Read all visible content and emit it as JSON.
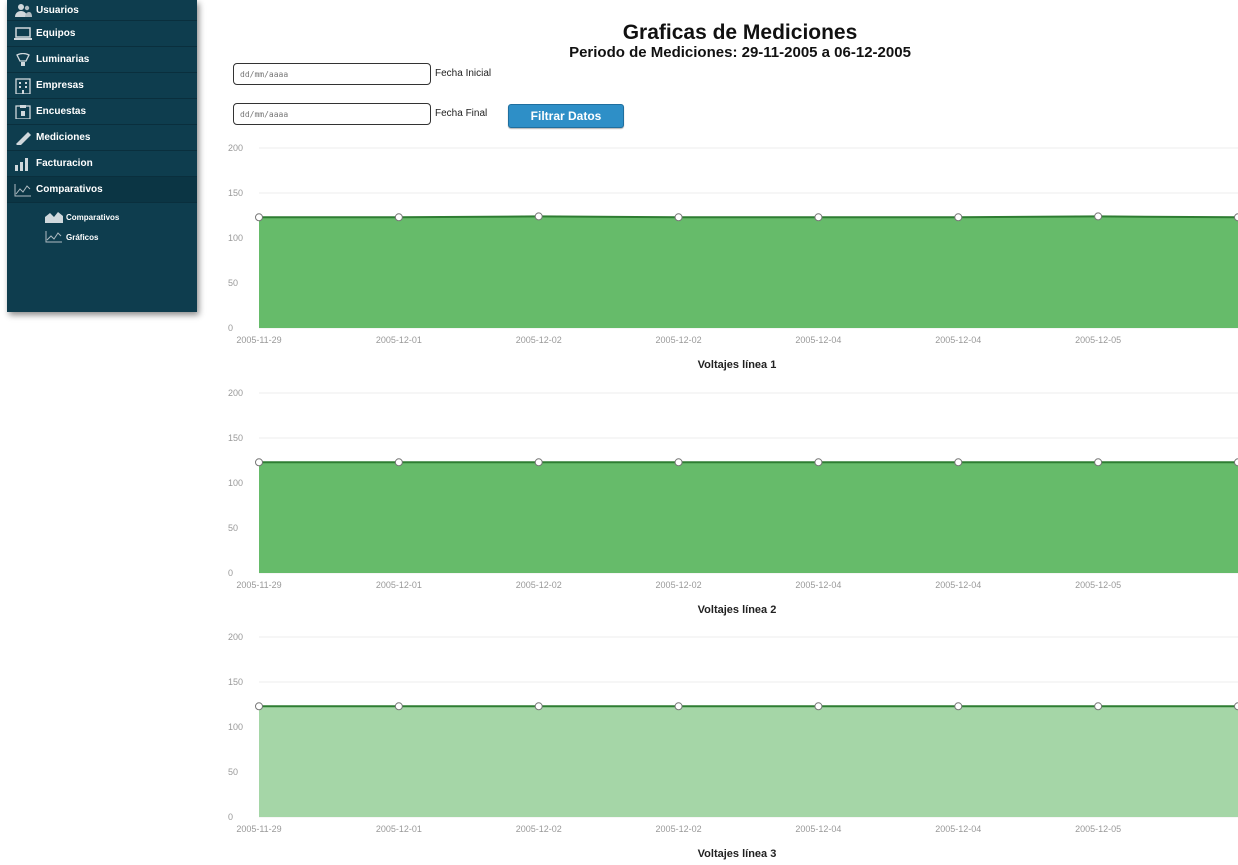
{
  "sidebar": {
    "items": [
      {
        "label": "Usuarios",
        "icon": "users-icon"
      },
      {
        "label": "Equipos",
        "icon": "computer-icon"
      },
      {
        "label": "Luminarias",
        "icon": "lamp-icon"
      },
      {
        "label": "Empresas",
        "icon": "building-icon"
      },
      {
        "label": "Encuestas",
        "icon": "clipboard-icon"
      },
      {
        "label": "Mediciones",
        "icon": "pencil-icon"
      },
      {
        "label": "Facturacion",
        "icon": "bar-chart-icon"
      },
      {
        "label": "Comparativos",
        "icon": "line-chart-icon"
      }
    ],
    "subitems": [
      {
        "label": "Comparativos",
        "icon": "area-chart-icon"
      },
      {
        "label": "Gráficos",
        "icon": "line-chart-icon"
      }
    ]
  },
  "header": {
    "title": "Graficas de Mediciones",
    "subtitle": "Periodo de Mediciones: 29-11-2005 a 06-12-2005"
  },
  "filters": {
    "start_placeholder": "dd/mm/aaaa",
    "start_label": "Fecha Inicial",
    "end_placeholder": "dd/mm/aaaa",
    "end_label": "Fecha Final",
    "button_label": "Filtrar Datos"
  },
  "colors": {
    "sidebar_bg": "#0e3d4e",
    "area_fill": "#66bb6a",
    "area_fill_light": "#a5d6a7",
    "line": "#2e7d32",
    "button": "#2e8fc7"
  },
  "chart_data": [
    {
      "type": "area",
      "title": "Voltajes línea 1",
      "x": [
        "2005-11-29",
        "2005-12-01",
        "2005-12-02",
        "2005-12-02",
        "2005-12-04",
        "2005-12-04",
        "2005-12-05",
        ""
      ],
      "values": [
        123,
        123,
        124,
        123,
        123,
        123,
        124,
        123
      ],
      "yticks": [
        0,
        50,
        100,
        150,
        200
      ],
      "ylim": [
        0,
        200
      ],
      "grid": true
    },
    {
      "type": "area",
      "title": "Voltajes línea 2",
      "x": [
        "2005-11-29",
        "2005-12-01",
        "2005-12-02",
        "2005-12-02",
        "2005-12-04",
        "2005-12-04",
        "2005-12-05",
        ""
      ],
      "values": [
        123,
        123,
        123,
        123,
        123,
        123,
        123,
        123
      ],
      "yticks": [
        0,
        50,
        100,
        150,
        200
      ],
      "ylim": [
        0,
        200
      ],
      "grid": true
    },
    {
      "type": "area",
      "title": "Voltajes línea 3",
      "x": [
        "2005-11-29",
        "2005-12-01",
        "2005-12-02",
        "2005-12-02",
        "2005-12-04",
        "2005-12-04",
        "2005-12-05",
        ""
      ],
      "values": [
        123,
        123,
        123,
        123,
        123,
        123,
        123,
        123
      ],
      "yticks": [
        0,
        50,
        100,
        150,
        200
      ],
      "ylim": [
        0,
        200
      ],
      "grid": true,
      "fill": "light"
    }
  ]
}
